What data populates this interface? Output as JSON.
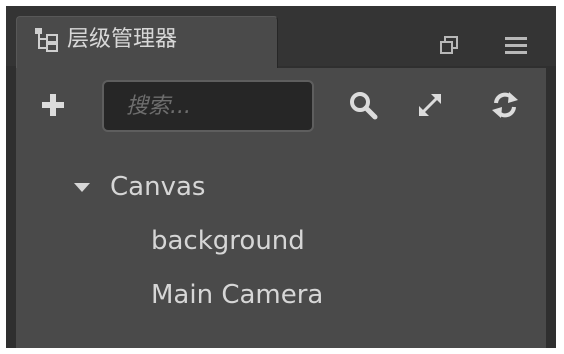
{
  "panel": {
    "title": "层级管理器",
    "title_icon": "hierarchy-icon",
    "window_buttons": [
      "restore-icon",
      "menu-icon"
    ]
  },
  "toolbar": {
    "add_icon": "plus-icon",
    "search_placeholder": "搜索...",
    "search_value": "",
    "search_icon": "search-icon",
    "expand_icon": "expand-icon",
    "refresh_icon": "refresh-icon"
  },
  "tree": {
    "root": {
      "label": "Canvas",
      "expanded": true
    },
    "children": [
      {
        "label": "background"
      },
      {
        "label": "Main Camera"
      }
    ]
  },
  "colors": {
    "panel_bg": "#4a4a4a",
    "outer_bg": "#2f2f2f",
    "text": "#d6d6d6",
    "input_bg": "#262626"
  }
}
